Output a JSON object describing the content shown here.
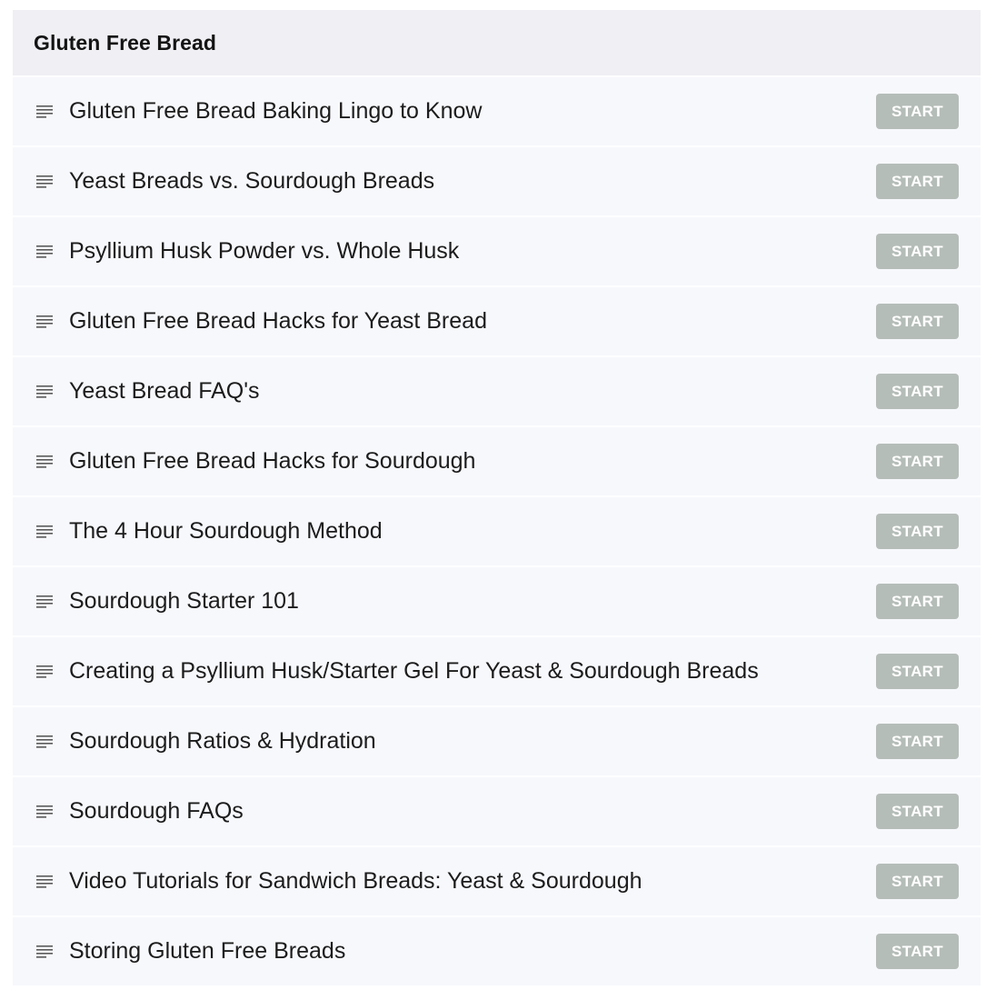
{
  "section": {
    "title": "Gluten Free Bread",
    "lesson_icon": "text-lines-icon",
    "lessons": [
      {
        "title": "Gluten Free Bread Baking Lingo to Know",
        "button": "START"
      },
      {
        "title": "Yeast Breads vs. Sourdough Breads",
        "button": "START"
      },
      {
        "title": "Psyllium Husk Powder vs. Whole Husk",
        "button": "START"
      },
      {
        "title": "Gluten Free Bread Hacks for Yeast Bread",
        "button": "START"
      },
      {
        "title": "Yeast Bread FAQ's",
        "button": "START"
      },
      {
        "title": "Gluten Free Bread Hacks for Sourdough",
        "button": "START"
      },
      {
        "title": "The 4 Hour Sourdough Method",
        "button": "START"
      },
      {
        "title": "Sourdough Starter 101",
        "button": "START"
      },
      {
        "title": "Creating a Psyllium Husk/Starter Gel For Yeast & Sourdough Breads",
        "button": "START"
      },
      {
        "title": "Sourdough Ratios & Hydration",
        "button": "START"
      },
      {
        "title": "Sourdough FAQs",
        "button": "START"
      },
      {
        "title": "Video Tutorials for Sandwich Breads: Yeast & Sourdough",
        "button": "START"
      },
      {
        "title": "Storing Gluten Free Breads",
        "button": "START"
      }
    ]
  },
  "colors": {
    "header_bg": "#efeff4",
    "row_bg": "#f7f8fc",
    "button_bg": "#b5bdb8",
    "button_text": "#ffffff",
    "icon": "#5a5a5a"
  }
}
